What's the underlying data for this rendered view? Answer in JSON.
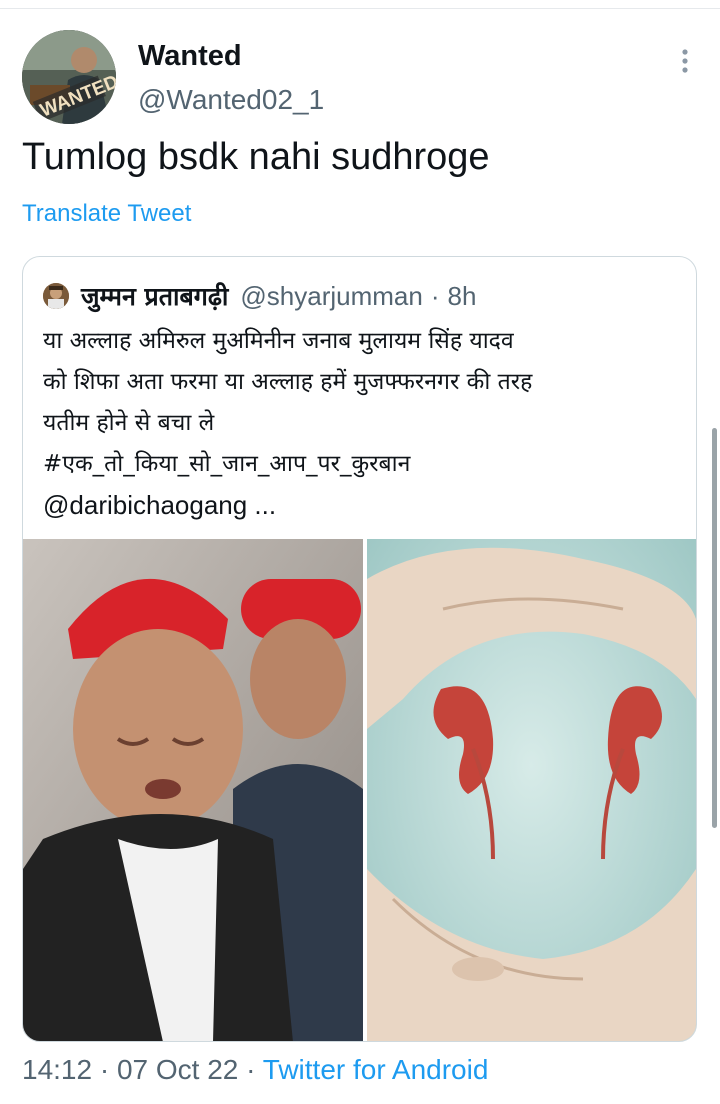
{
  "tweet": {
    "author_name": "Wanted",
    "author_handle": "@Wanted02_1",
    "avatar_text": "WANTED",
    "text": "Tumlog bsdk nahi sudhroge",
    "translate_label": "Translate Tweet",
    "time": "14:12",
    "date": "07 Oct 22",
    "source": "Twitter for Android",
    "separator": "·"
  },
  "quoted": {
    "author_name": "जुम्मन प्रताबगढ़ी",
    "author_handle": "@shyarjumman",
    "age": "8h",
    "lines": [
      "या अल्लाह अमिरुल मुअमिनीन जनाब मुलायम सिंह यादव",
      "को शिफा अता फरमा या अल्लाह हमें मुजफ्फरनगर की तरह",
      "यतीम होने से बचा ले",
      "#एक_तो_किया_सो_जान_आप_पर_कुरबान"
    ],
    "mention_line": "@daribichaogang ..."
  },
  "colors": {
    "link": "#1d9bf0",
    "secondary": "#536471",
    "cap_red": "#d8232a",
    "kidney": "#c5443a",
    "teal_bg": "#a9cfcc"
  },
  "icons": {
    "more": "more-vertical-icon"
  }
}
